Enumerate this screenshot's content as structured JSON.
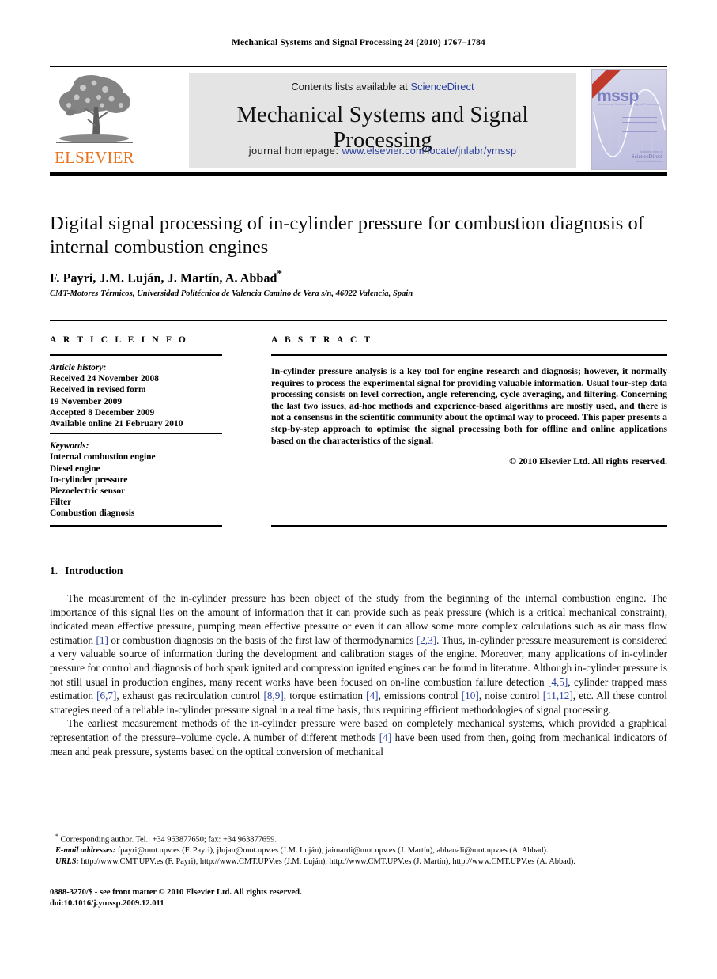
{
  "running_head": "Mechanical Systems and Signal Processing 24 (2010) 1767–1784",
  "masthead": {
    "publisher_name": "ELSEVIER",
    "publisher_logo_icon": "elsevier-tree-icon",
    "contents_prefix": "Contents lists available at ",
    "contents_link": "ScienceDirect",
    "journal_name": "Mechanical Systems and Signal Processing",
    "homepage_prefix": "journal homepage: ",
    "homepage_url": "www.elsevier.com/locate/jnlabr/ymssp",
    "cover": {
      "acronym": "mssp",
      "subtitle": "Mechanical Systems and Signal Processing",
      "logo_line1": "Available online at",
      "logo_line2": "ScienceDirect",
      "logo_line3": "www.sciencedirect.com"
    },
    "link_color": "#2a3f9d",
    "brand_color": "#E8721C"
  },
  "article": {
    "title": "Digital signal processing of in-cylinder pressure for combustion diagnosis of internal combustion engines",
    "authors": "F. Payri, J.M. Luján, J. Martín, A. Abbad",
    "corresponding_marker": "*",
    "affiliation": "CMT-Motores Térmicos, Universidad Politécnica de Valencia Camino de Vera s/n, 46022 Valencia, Spain"
  },
  "info": {
    "heading": "A R T I C L E   I N F O",
    "history_label": "Article history:",
    "history_lines": [
      "Received 24 November 2008",
      "Received in revised form",
      "19 November 2009",
      "Accepted 8 December 2009",
      "Available online 21 February 2010"
    ],
    "keywords_label": "Keywords:",
    "keywords": [
      "Internal combustion engine",
      "Diesel engine",
      "In-cylinder pressure",
      "Piezoelectric sensor",
      "Filter",
      "Combustion diagnosis"
    ]
  },
  "abstract": {
    "heading": "A B S T R A C T",
    "text": "In-cylinder pressure analysis is a key tool for engine research and diagnosis; however, it normally requires to process the experimental signal for providing valuable information. Usual four-step data processing consists on level correction, angle referencing, cycle averaging, and filtering. Concerning the last two issues, ad-hoc methods and experience-based algorithms are mostly used, and there is not a consensus in the scientific community about the optimal way to proceed. This paper presents a step-by-step approach to optimise the signal processing both for offline and online applications based on the characteristics of the signal.",
    "copyright": "© 2010 Elsevier Ltd. All rights reserved."
  },
  "body": {
    "section_number": "1.",
    "section_title": "Introduction",
    "paragraph1_parts": [
      "The measurement of the in-cylinder pressure has been object of the study from the beginning of the internal combustion engine. The importance of this signal lies on the amount of information that it can provide such as peak pressure (which is a critical mechanical constraint), indicated mean effective pressure, pumping mean effective pressure or even it can allow some more complex calculations such as air mass flow estimation ",
      "[1]",
      " or combustion diagnosis on the basis of the first law of thermodynamics ",
      "[2,3]",
      ". Thus, in-cylinder pressure measurement is considered a very valuable source of information during the development and calibration stages of the engine. Moreover, many applications of in-cylinder pressure for control and diagnosis of both spark ignited and compression ignited engines can be found in literature. Although in-cylinder pressure is not still usual in production engines, many recent works have been focused on on-line combustion failure detection ",
      "[4,5]",
      ", cylinder trapped mass estimation ",
      "[6,7]",
      ", exhaust gas recirculation control ",
      "[8,9]",
      ", torque estimation ",
      "[4]",
      ", emissions control ",
      "[10]",
      ", noise control ",
      "[11,12]",
      ", etc. All these control strategies need of a reliable in-cylinder pressure signal in a real time basis, thus requiring efficient methodologies of signal processing."
    ],
    "paragraph2_parts": [
      "The earliest measurement methods of the in-cylinder pressure were based on completely mechanical systems, which provided a graphical representation of the pressure–volume cycle. A number of different methods ",
      "[4]",
      " have been used from then, going from mechanical indicators of mean and peak pressure, systems based on the optical conversion of mechanical"
    ]
  },
  "footnotes": {
    "corresponding": "Corresponding author. Tel.: +34 963877650; fax: +34 963877659.",
    "email_label": "E-mail addresses:",
    "email_text": " fpayri@mot.upv.es (F. Payri), jlujan@mot.upv.es (J.M. Luján), jaimardi@mot.upv.es (J. Martín), abbanali@mot.upv.es (A. Abbad).",
    "urls_label": "URLS:",
    "urls_text": " http://www.CMT.UPV.es (F. Payri), http://www.CMT.UPV.es (J.M. Luján), http://www.CMT.UPV.es (J. Martín), http://www.CMT.UPV.es (A. Abbad)."
  },
  "imprint": {
    "issn_line": "0888-3270/$ - see front matter © 2010 Elsevier Ltd. All rights reserved.",
    "doi_line": "doi:10.1016/j.ymssp.2009.12.011"
  }
}
